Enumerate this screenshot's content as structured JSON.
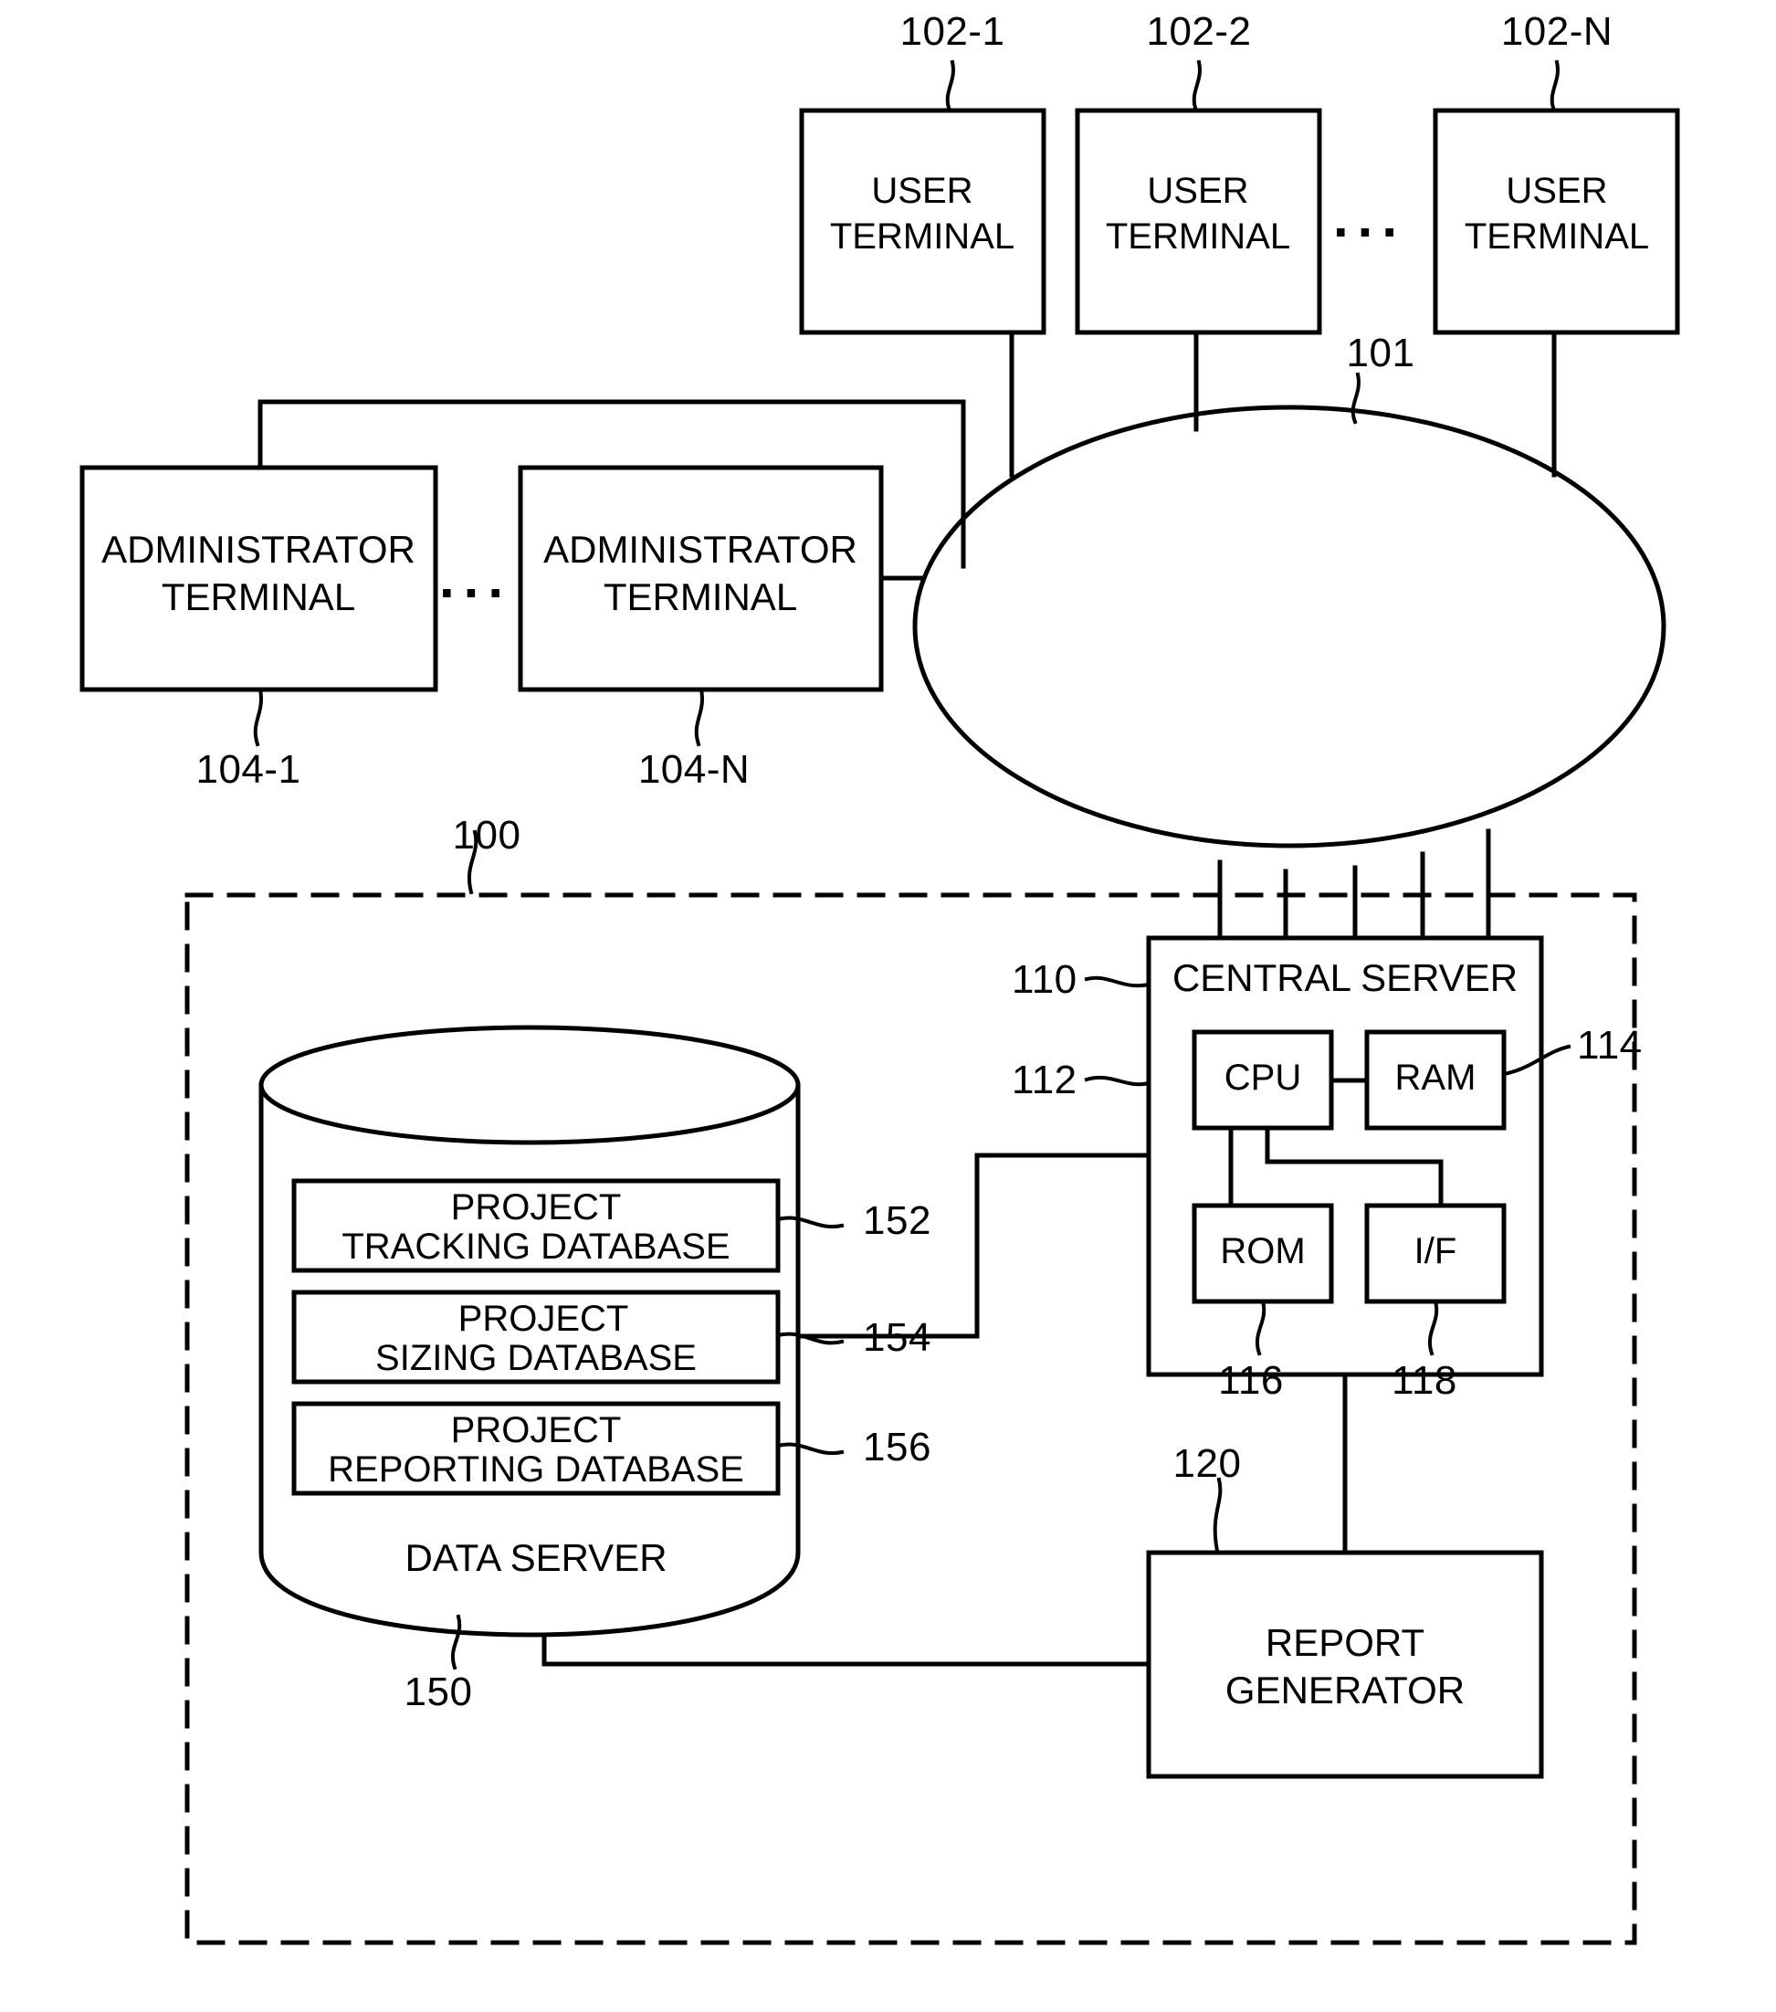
{
  "figure": {
    "title": "System architecture block diagram",
    "line_color": "#000000",
    "background": "#ffffff"
  },
  "nodes": {
    "user_terminals": [
      {
        "id": "102-1",
        "label_line1": "USER",
        "label_line2": "TERMINAL",
        "ref": "102-1"
      },
      {
        "id": "102-2",
        "label_line1": "USER",
        "label_line2": "TERMINAL",
        "ref": "102-2"
      },
      {
        "id": "102-N",
        "label_line1": "USER",
        "label_line2": "TERMINAL",
        "ref": "102-N"
      }
    ],
    "user_terminal_ellipsis": "...",
    "admin_terminals": [
      {
        "id": "104-1",
        "label_line1": "ADMINISTRATOR",
        "label_line2": "TERMINAL",
        "ref": "104-1"
      },
      {
        "id": "104-N",
        "label_line1": "ADMINISTRATOR",
        "label_line2": "TERMINAL",
        "ref": "104-N"
      }
    ],
    "admin_terminal_ellipsis": "...",
    "network": {
      "ref": "101"
    },
    "system_boundary": {
      "ref": "100"
    },
    "central_server": {
      "label": "CENTRAL SERVER",
      "ref": "110",
      "components": [
        {
          "label": "CPU",
          "ref": "112"
        },
        {
          "label": "RAM",
          "ref": "114"
        },
        {
          "label": "ROM",
          "ref": "116"
        },
        {
          "label": "I/F",
          "ref": "118"
        }
      ]
    },
    "data_server": {
      "label": "DATA SERVER",
      "ref": "150",
      "databases": [
        {
          "label_line1": "PROJECT",
          "label_line2": "TRACKING DATABASE",
          "ref": "152"
        },
        {
          "label_line1": "PROJECT",
          "label_line2": "SIZING DATABASE",
          "ref": "154"
        },
        {
          "label_line1": "PROJECT",
          "label_line2": "REPORTING DATABASE",
          "ref": "156"
        }
      ]
    },
    "report_generator": {
      "label_line1": "REPORT",
      "label_line2": "GENERATOR",
      "ref": "120"
    }
  }
}
